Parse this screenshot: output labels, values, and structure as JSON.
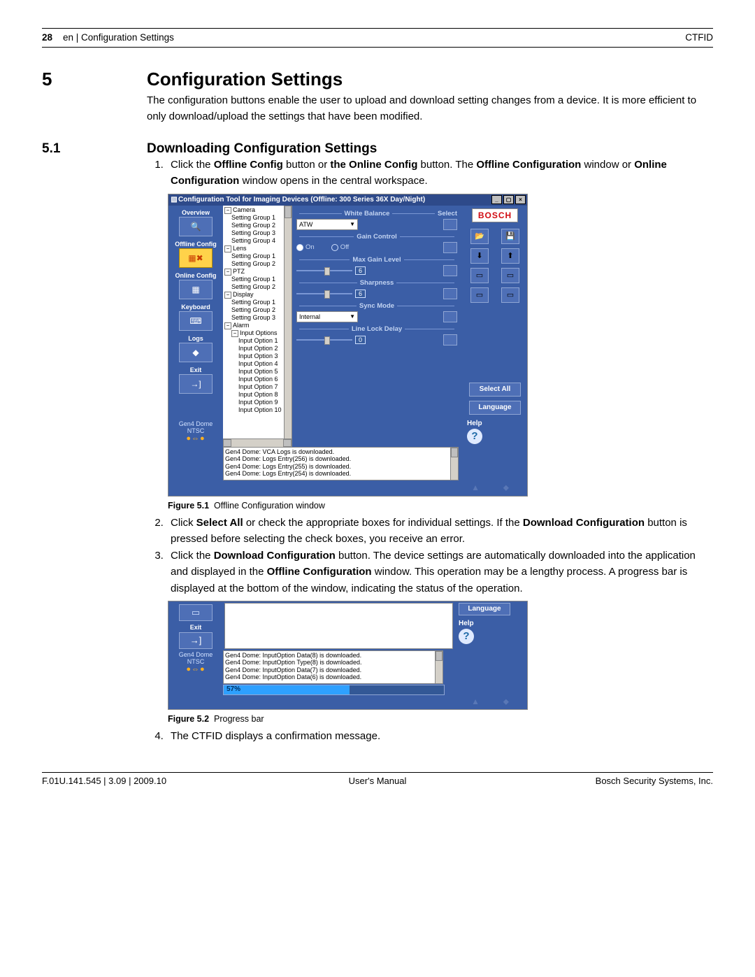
{
  "header": {
    "page_num": "28",
    "breadcrumb": "en | Configuration Settings",
    "right": "CTFID"
  },
  "s5": {
    "num": "5",
    "title": "Configuration Settings",
    "intro": "The configuration buttons enable the user to upload and download setting changes from a device. It is more efficient to only download/upload the settings that have been modified."
  },
  "s51": {
    "num": "5.1",
    "title": "Downloading Configuration Settings",
    "step1_a": "Click the ",
    "step1_b": "Offline Config",
    "step1_c": " button or ",
    "step1_d": "the Online Config",
    "step1_e": " button. The ",
    "step1_f": "Offline Configuration",
    "step1_g": " window or ",
    "step1_h": "Online Configuration",
    "step1_i": " window opens in the central workspace.",
    "step2_a": "Click ",
    "step2_b": "Select All",
    "step2_c": " or check the appropriate boxes for individual settings. If the ",
    "step2_d": "Download Configuration",
    "step2_e": " button is pressed before selecting the check boxes, you receive an error.",
    "step3_a": "Click the ",
    "step3_b": "Download Configuration",
    "step3_c": " button. The device settings are automatically downloaded into the application and displayed in the ",
    "step3_d": "Offline Configuration",
    "step3_e": " window. This operation may be a lengthy process. A progress bar is displayed at the bottom of the window, indicating the status of the operation.",
    "step4": "The CTFID displays a confirmation message."
  },
  "fig1_cap": {
    "label": "Figure 5.1",
    "text": "Offline Configuration window"
  },
  "fig2_cap": {
    "label": "Figure 5.2",
    "text": "Progress bar"
  },
  "app": {
    "title": "Configuration Tool for Imaging Devices (Offline: 300 Series 36X Day/Night)",
    "nav": {
      "overview": "Overview",
      "offline": "Offline Config",
      "online": "Online Config",
      "keyboard": "Keyboard",
      "logs": "Logs",
      "exit": "Exit"
    },
    "info": {
      "model": "Gen4 Dome",
      "std": "NTSC",
      "dots": "●⇔●"
    },
    "tree": {
      "camera": "Camera",
      "sg1": "Setting Group 1",
      "sg2": "Setting Group 2",
      "sg3": "Setting Group 3",
      "sg4": "Setting Group 4",
      "lens": "Lens",
      "ptz": "PTZ",
      "display": "Display",
      "alarm": "Alarm",
      "inopt": "Input Options",
      "io1": "Input Option 1",
      "io2": "Input Option 2",
      "io3": "Input Option 3",
      "io4": "Input Option 4",
      "io5": "Input Option 5",
      "io6": "Input Option 6",
      "io7": "Input Option 7",
      "io8": "Input Option 8",
      "io9": "Input Option 9",
      "io10": "Input Option 10"
    },
    "center": {
      "wb": "White Balance",
      "select": "Select",
      "atw": "ATW",
      "gain": "Gain Control",
      "on": "On",
      "off": "Off",
      "maxgain": "Max Gain Level",
      "v6": "6",
      "sharp": "Sharpness",
      "v6b": "6",
      "sync": "Sync Mode",
      "internal": "Internal",
      "lld": "Line Lock Delay",
      "v0": "0"
    },
    "right": {
      "logo": "BOSCH",
      "selall": "Select All",
      "lang": "Language",
      "help": "Help"
    },
    "log": {
      "l1": "Gen4 Dome: VCA Logs is downloaded.",
      "l2": "Gen4 Dome: Logs Entry(256) is downloaded.",
      "l3": "Gen4 Dome: Logs Entry(255) is downloaded.",
      "l4": "Gen4 Dome: Logs Entry(254) is downloaded."
    }
  },
  "app2": {
    "exit": "Exit",
    "lang": "Language",
    "help": "Help",
    "log": {
      "l1": "Gen4 Dome: InputOption Data(8) is downloaded.",
      "l2": "Gen4 Dome: InputOption Type(8) is downloaded.",
      "l3": "Gen4 Dome: InputOption Data(7) is downloaded.",
      "l4": "Gen4 Dome: InputOption Data(6) is downloaded."
    },
    "pct": "57%"
  },
  "footer": {
    "left": "F.01U.141.545 | 3.09 | 2009.10",
    "center": "User's Manual",
    "right": "Bosch Security Systems, Inc."
  }
}
